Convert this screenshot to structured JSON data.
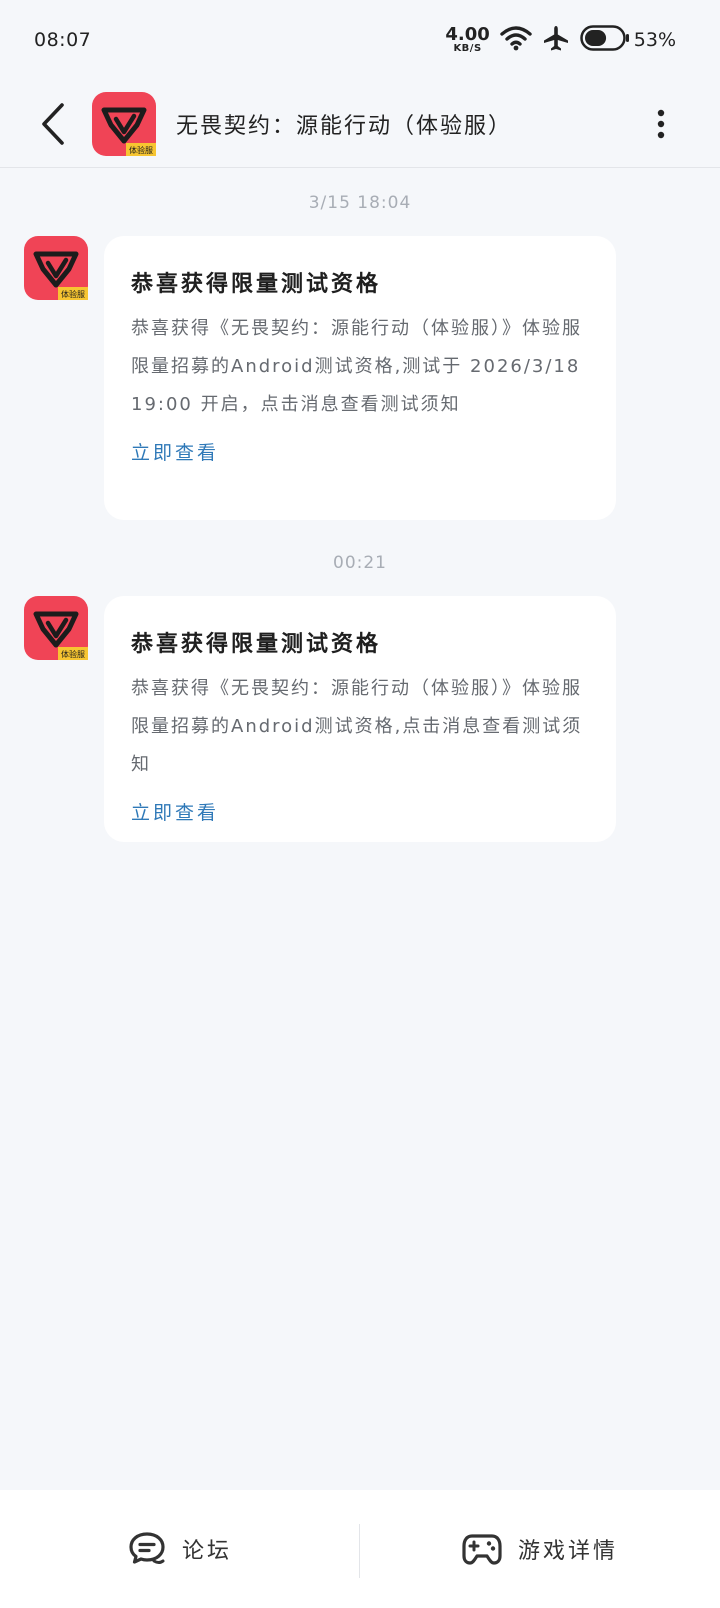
{
  "status_bar": {
    "time": "08:07",
    "net_speed_value": "4.00",
    "net_speed_unit": "KB/S",
    "battery_percent": "53%",
    "battery_level": 0.53
  },
  "header": {
    "title": "无畏契约：源能行动（体验服）",
    "logo_badge": "体验服"
  },
  "messages": [
    {
      "timestamp": "3/15  18:04",
      "title": "恭喜获得限量测试资格",
      "body": "恭喜获得《无畏契约：源能行动（体验服）》体验服限量招募的Android测试资格,测试于 2026/3/18 19:00 开启，点击消息查看测试须知",
      "link": "立即查看"
    },
    {
      "timestamp": "00:21",
      "title": "恭喜获得限量测试资格",
      "body": "恭喜获得《无畏契约：源能行动（体验服）》体验服限量招募的Android测试资格,点击消息查看测试须知",
      "link": "立即查看"
    }
  ],
  "bottom_bar": {
    "forum_label": "论坛",
    "game_details_label": "游戏详情"
  },
  "colors": {
    "accent_link": "#2f79b8",
    "logo_red": "#f04456",
    "logo_badge": "#f7c531",
    "background": "#f5f7fa"
  },
  "icons": {
    "back": "chevron-left-icon",
    "more": "more-vertical-icon",
    "forum": "chat-bubble-icon",
    "game": "gamepad-icon",
    "wifi": "wifi-icon",
    "airplane": "airplane-icon",
    "battery": "battery-icon"
  }
}
